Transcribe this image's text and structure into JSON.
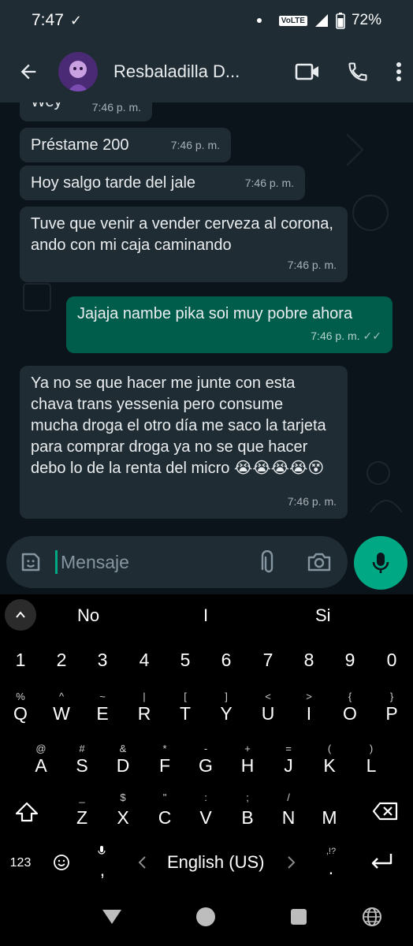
{
  "status_bar": {
    "time": "7:47",
    "check": "✓",
    "volte": "VoLTE",
    "battery": "72%"
  },
  "header": {
    "contact_name": "Resbaladilla D..."
  },
  "messages": [
    {
      "text": "Wey",
      "time": "7:46 p. m."
    },
    {
      "text": "Préstame 200",
      "time": "7:46 p. m."
    },
    {
      "text": "Hoy salgo tarde del jale",
      "time": "7:46 p. m."
    },
    {
      "text": "Tuve que venir a vender cerveza al corona, ando con mi caja caminando",
      "time": "7:46 p. m."
    },
    {
      "text": "Jajaja nambe pika soi muy pobre ahora",
      "time": "7:46 p. m."
    },
    {
      "text": "Ya no se que hacer me junte con esta chava trans yessenia pero consume mucha droga el otro día me saco la tarjeta para comprar droga ya no se que hacer debo lo de la renta del micro 😭😭😭😭😵",
      "time": "7:46 p. m."
    }
  ],
  "input": {
    "placeholder": "Mensaje"
  },
  "keyboard": {
    "suggestions": [
      "No",
      "I",
      "Si"
    ],
    "number_row": [
      "1",
      "2",
      "3",
      "4",
      "5",
      "6",
      "7",
      "8",
      "9",
      "0"
    ],
    "row1": [
      "Q",
      "W",
      "E",
      "R",
      "T",
      "Y",
      "U",
      "I",
      "O",
      "P"
    ],
    "row1_sup": [
      "%",
      "^",
      "~",
      "|",
      "[",
      "]",
      "<",
      ">",
      "{",
      "}"
    ],
    "row2": [
      "A",
      "S",
      "D",
      "F",
      "G",
      "H",
      "J",
      "K",
      "L"
    ],
    "row2_sup": [
      "@",
      "#",
      "&",
      "*",
      "-",
      "+",
      "=",
      "(",
      ")"
    ],
    "row3": [
      "Z",
      "X",
      "C",
      "V",
      "B",
      "N",
      "M"
    ],
    "row3_sup": [
      "_",
      "$",
      "\"",
      ":",
      ";",
      "/",
      ""
    ],
    "symbols_key": "123",
    "space_label": "English (US)",
    "comma": ",",
    "period": ".",
    "punct_sup": ",!?"
  }
}
